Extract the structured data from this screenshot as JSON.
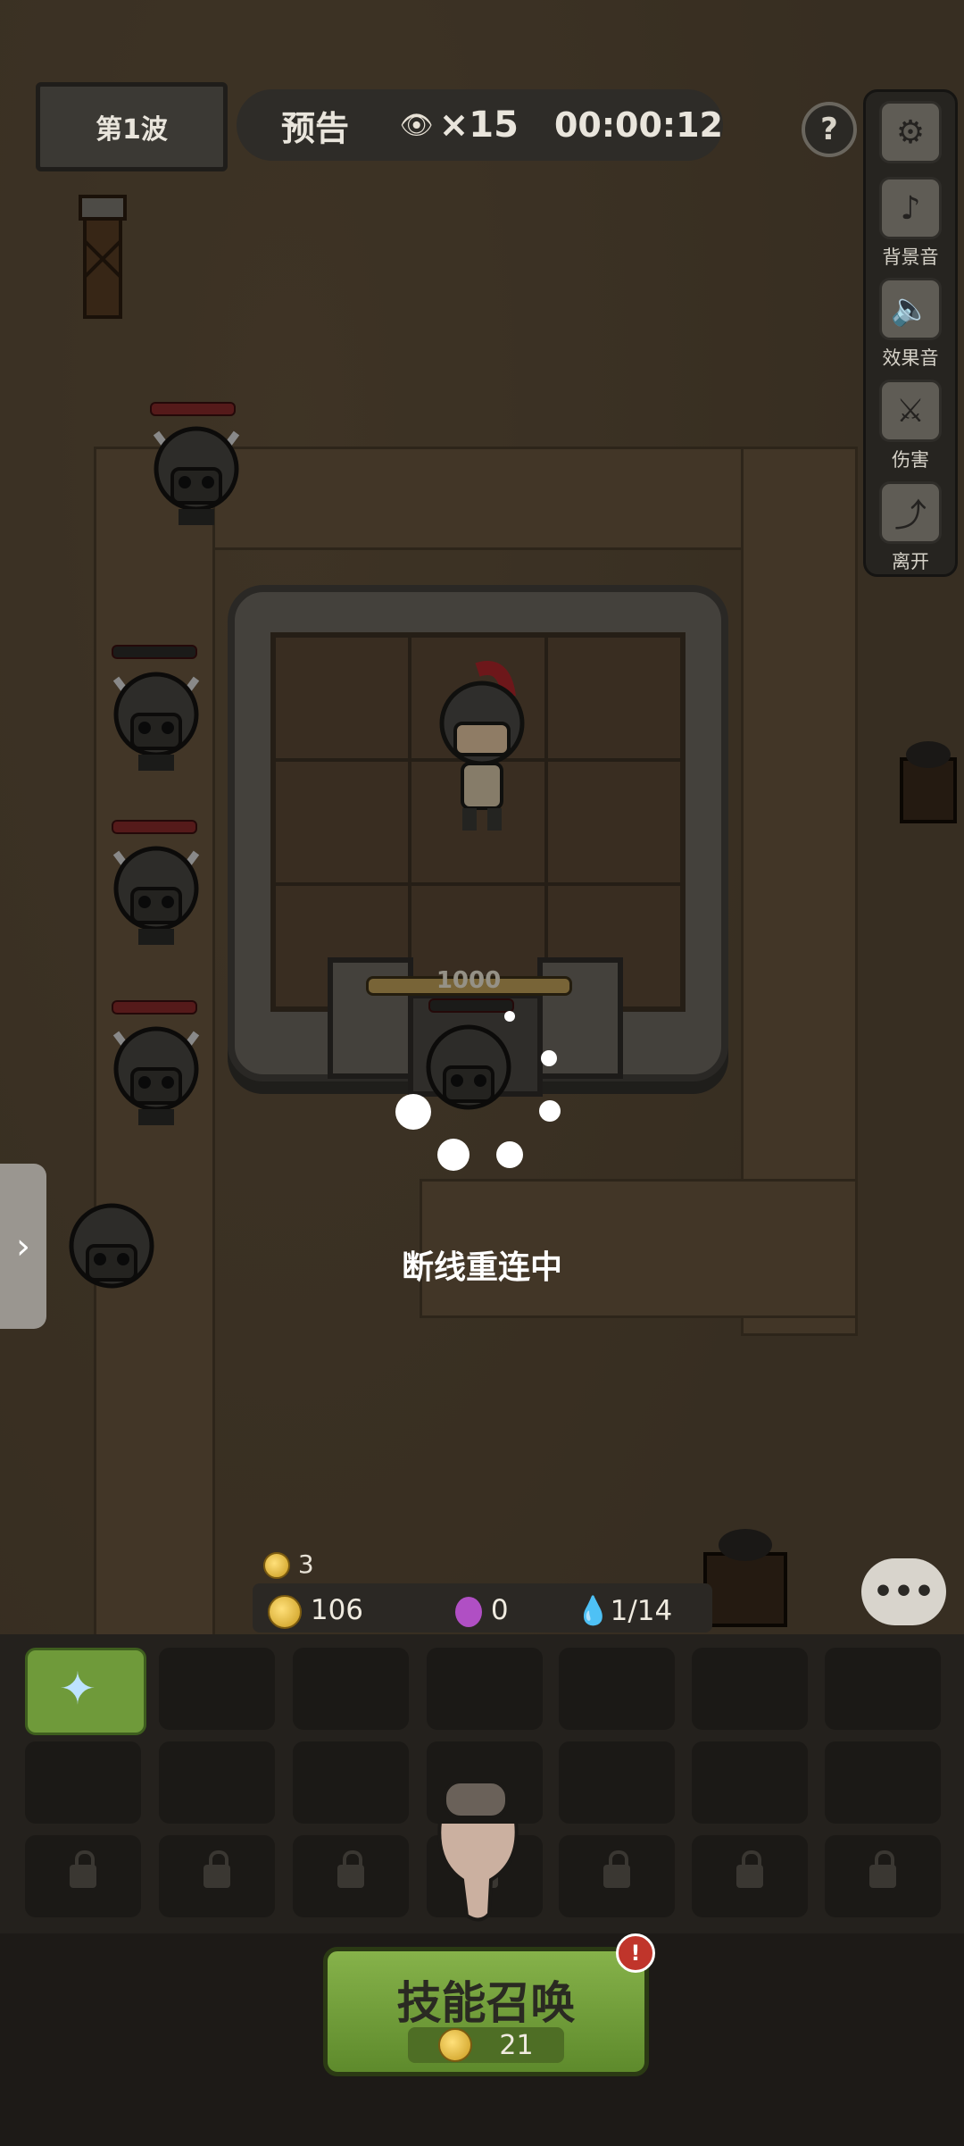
{
  "wave": {
    "label": "第1波"
  },
  "forecast": {
    "label": "预告",
    "eye_icon": "eye-icon",
    "count": "×15",
    "timer": "00:00:12"
  },
  "help": {
    "label": "?"
  },
  "side_menu": {
    "items": [
      {
        "name": "settings",
        "icon": "gear-icon",
        "label": ""
      },
      {
        "name": "bgm",
        "icon": "music-note-icon",
        "label": "背景音"
      },
      {
        "name": "sfx",
        "icon": "speaker-icon",
        "label": "效果音"
      },
      {
        "name": "damage",
        "icon": "crossed-swords-icon",
        "label": "伤害"
      },
      {
        "name": "leave",
        "icon": "exit-icon",
        "label": "离开"
      }
    ]
  },
  "castle": {
    "hp": "1000"
  },
  "status": {
    "reconnect": "断线重连中"
  },
  "resources": {
    "stack_count": "3",
    "gold": "106",
    "gem": "0",
    "units": "1/14"
  },
  "summon": {
    "label": "技能召唤",
    "cost": "21",
    "badge": "!"
  },
  "colors": {
    "accent_green": "#6f9a3a",
    "hp_red": "#8a2a2a",
    "gold": "#e0b52f"
  }
}
